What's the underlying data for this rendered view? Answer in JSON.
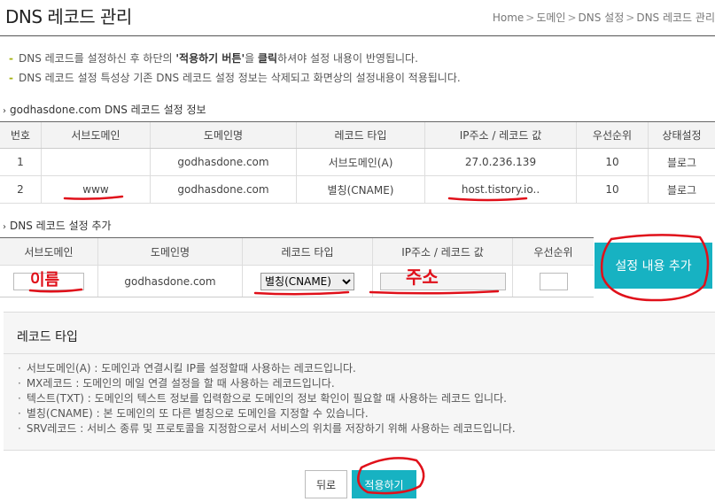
{
  "page": {
    "title": "DNS 레코드 관리",
    "breadcrumb": [
      "Home",
      "도메인",
      "DNS 설정",
      "DNS 레코드 관리"
    ]
  },
  "notices": {
    "line1_pre": "DNS 레코드를 설정하신 후 하단의 ",
    "line1_bold1": "'적용하기 버튼'",
    "line1_mid": "을 ",
    "line1_bold2": "클릭",
    "line1_post": "하셔야 설정 내용이 반영됩니다.",
    "line2": "DNS 레코드 설정 특성상 기존 DNS 레코드 설정 정보는 삭제되고 화면상의 설정내용이 적용됩니다."
  },
  "records_section": {
    "title": "godhasdone.com DNS 레코드 설정 정보",
    "headers": [
      "번호",
      "서브도메인",
      "도메인명",
      "레코드 타입",
      "IP주소 / 레코드 값",
      "우선순위",
      "상태설정"
    ],
    "rows": [
      [
        "1",
        "",
        "godhasdone.com",
        "서브도메인(A)",
        "27.0.236.139",
        "10",
        "블로그"
      ],
      [
        "2",
        "www",
        "godhasdone.com",
        "별칭(CNAME)",
        "host.tistory.io..",
        "10",
        "블로그"
      ]
    ]
  },
  "add_section": {
    "title": "DNS 레코드 설정 추가",
    "headers": [
      "서브도메인",
      "도메인명",
      "레코드 타입",
      "IP주소 / 레코드 값",
      "우선순위"
    ],
    "domain": "godhasdone.com",
    "record_type_selected": "별칭(CNAME)",
    "add_button": "설정 내용 추가"
  },
  "help": {
    "title": "레코드 타입",
    "items": [
      "서브도메인(A) : 도메인과 연결시킬 IP를 설정할때 사용하는 레코드입니다.",
      "MX레코드 : 도메인의 메일 연결 설정을 할 때 사용하는 레코드입니다.",
      "텍스트(TXT) : 도메인의 텍스트 정보를 입력함으로 도메인의 정보 확인이 필요할 때 사용하는 레코드 입니다.",
      "별칭(CNAME) : 본 도메인의 또 다른 별칭으로 도메인을 지정할 수 있습니다.",
      "SRV레코드 : 서비스 종류 및 프로토콜을 지정함으로서 서비스의 위치를 저장하기 위해 사용하는 레코드입니다."
    ]
  },
  "actions": {
    "back": "뒤로",
    "apply": "적용하기"
  },
  "annotations": {
    "subdomain_scribble": "이름",
    "ip_scribble": "주소",
    "color": "#e0101a"
  },
  "colors": {
    "accent": "#17b2c2",
    "notice_dash": "#a3b20e"
  }
}
